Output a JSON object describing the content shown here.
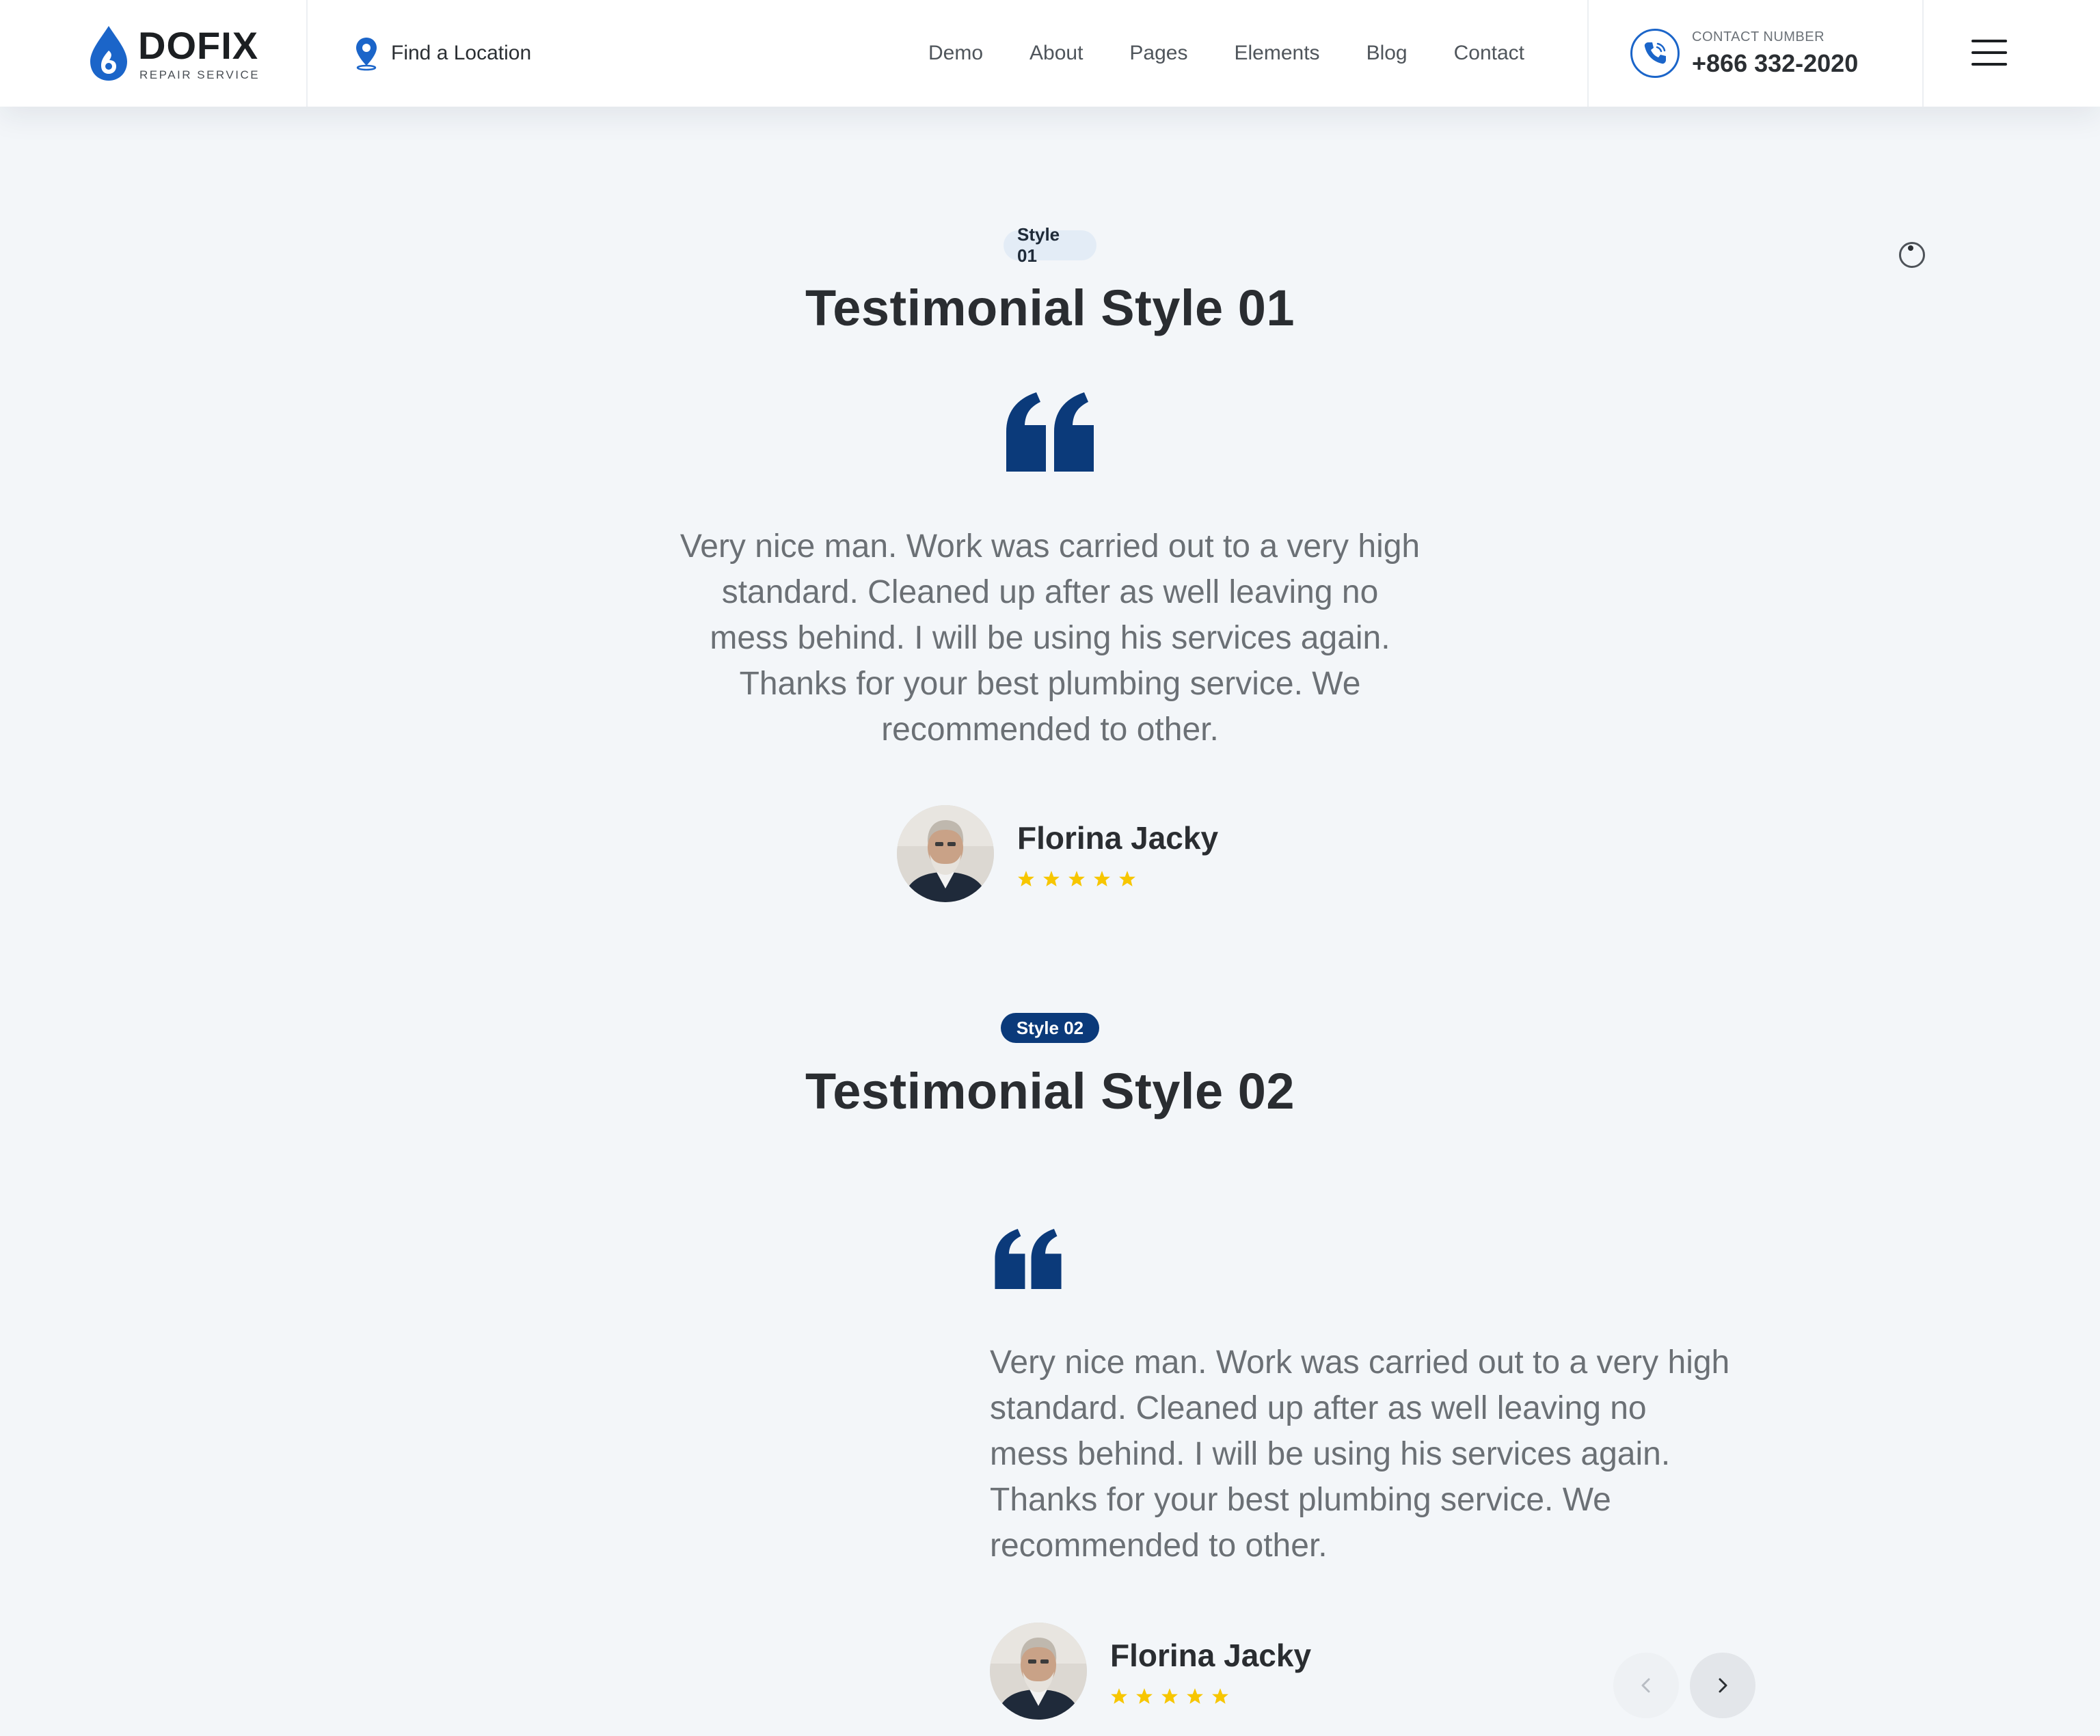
{
  "header": {
    "logo_name": "DOFIX",
    "logo_sub": "REPAIR SERVICE",
    "find_location": "Find a Location",
    "nav": [
      "Demo",
      "About",
      "Pages",
      "Elements",
      "Blog",
      "Contact"
    ],
    "contact_label": "CONTACT NUMBER",
    "contact_number": "+866 332-2020"
  },
  "style1": {
    "badge": "Style 01",
    "title": "Testimonial Style 01",
    "quote_lines": [
      "Very nice man. Work was carried out to a very high",
      "standard. Cleaned up after as well leaving no",
      "mess behind. I will be using his services again.",
      "Thanks for your best plumbing service. We",
      "recommended to other."
    ],
    "author_name": "Florina Jacky",
    "rating": 5
  },
  "style2": {
    "badge": "Style 02",
    "title": "Testimonial Style 02",
    "quote_lines": [
      "Very nice man. Work was carried out to a very high",
      "standard. Cleaned up after as well leaving no",
      "mess behind. I will be using his services again.",
      "Thanks for your best plumbing service. We",
      "recommended to other."
    ],
    "author_name": "Florina Jacky",
    "rating": 5
  },
  "icons": {
    "location": "map-pin-icon",
    "phone": "phone-icon",
    "menu": "hamburger-menu-icon",
    "quote": "quote-icon",
    "star": "star-icon",
    "prev": "chevron-left-icon",
    "next": "chevron-right-icon",
    "loader": "spinner-icon"
  },
  "colors": {
    "brand_blue": "#1b65c9",
    "navy": "#0b3a7a",
    "star": "#f7c600",
    "background": "#f3f6f9"
  }
}
